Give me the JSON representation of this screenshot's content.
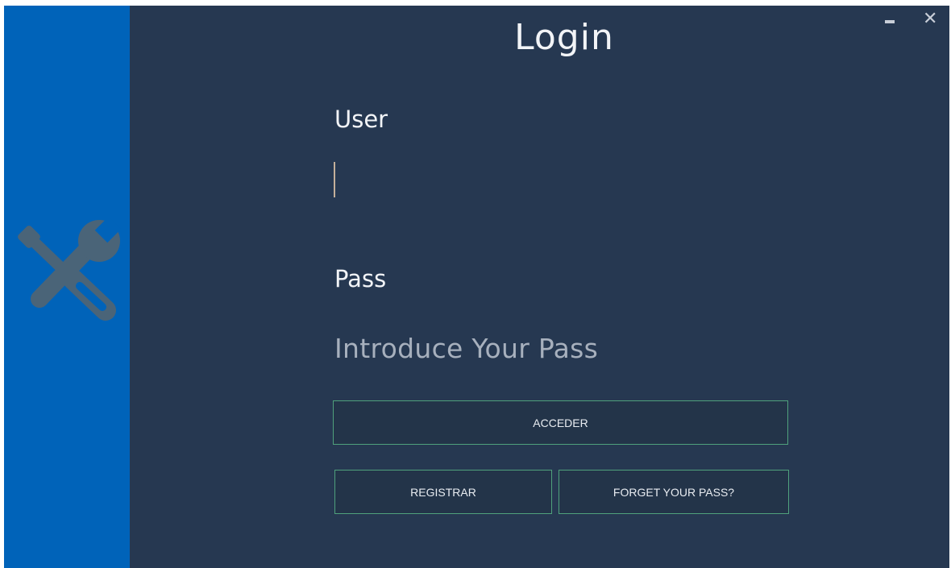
{
  "login": {
    "title": "Login",
    "user_label": "User",
    "user_value": "",
    "pass_label": "Pass",
    "pass_placeholder": "Introduce Your Pass"
  },
  "buttons": {
    "acceder": "ACCEDER",
    "registrar": "REGISTRAR",
    "forget": "FORGET YOUR PASS?"
  },
  "window_controls": {
    "close_glyph": "✕"
  },
  "colors": {
    "background": "#263851",
    "sidebar": "#0063b9",
    "logo": "#4a6478",
    "button_border": "#4fa17c",
    "button_fill": "#233449"
  },
  "icons": {
    "logo": "tools-icon",
    "minimize": "minimize-icon",
    "close": "close-icon"
  }
}
